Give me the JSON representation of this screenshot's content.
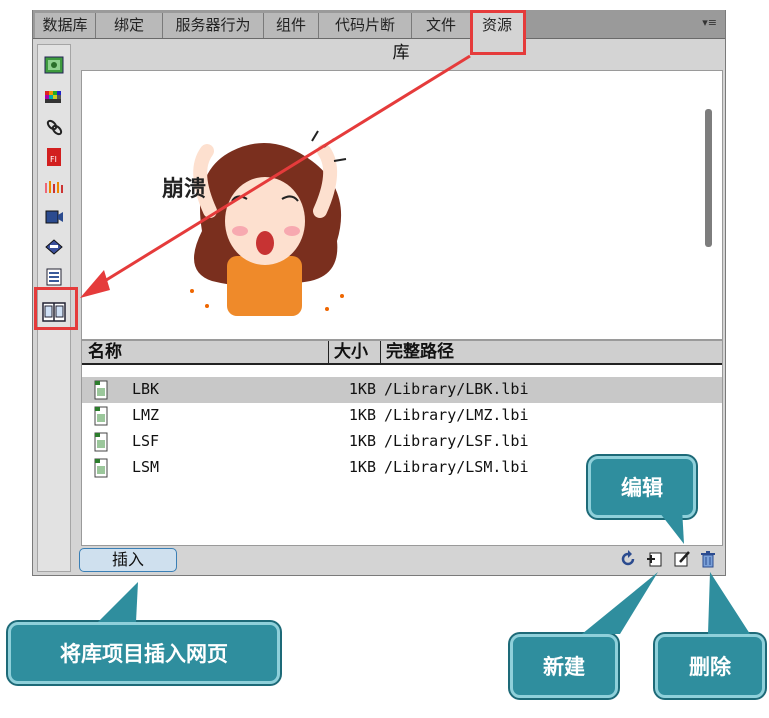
{
  "tabs": [
    "数据库",
    "绑定",
    "服务器行为",
    "组件",
    "代码片断",
    "文件",
    "资源"
  ],
  "active_tab": "资源",
  "library_title": "库",
  "columns": {
    "name": "名称",
    "size": "大小",
    "path": "完整路径"
  },
  "items": [
    {
      "name": "LBK",
      "size": "1KB",
      "path": "/Library/LBK.lbi",
      "selected": true
    },
    {
      "name": "LMZ",
      "size": "1KB",
      "path": "/Library/LMZ.lbi",
      "selected": false
    },
    {
      "name": "LSF",
      "size": "1KB",
      "path": "/Library/LSF.lbi",
      "selected": false
    },
    {
      "name": "LSM",
      "size": "1KB",
      "path": "/Library/LSM.lbi",
      "selected": false
    }
  ],
  "insert_button": "插入",
  "bottom_icons": [
    "refresh-icon",
    "new-item-icon",
    "edit-icon",
    "trash-icon"
  ],
  "left_icons": [
    "images-icon",
    "colors-icon",
    "urls-icon",
    "flash-icon",
    "shockwave-icon",
    "movies-icon",
    "scripts-icon",
    "templates-icon",
    "library-icon"
  ],
  "callouts": {
    "insert": "将库项目插入网页",
    "edit": "编辑",
    "new": "新建",
    "delete": "删除"
  },
  "preview_text": "崩溃",
  "colors": {
    "highlight": "#e53b3b",
    "callout": "#2f8e9e"
  }
}
